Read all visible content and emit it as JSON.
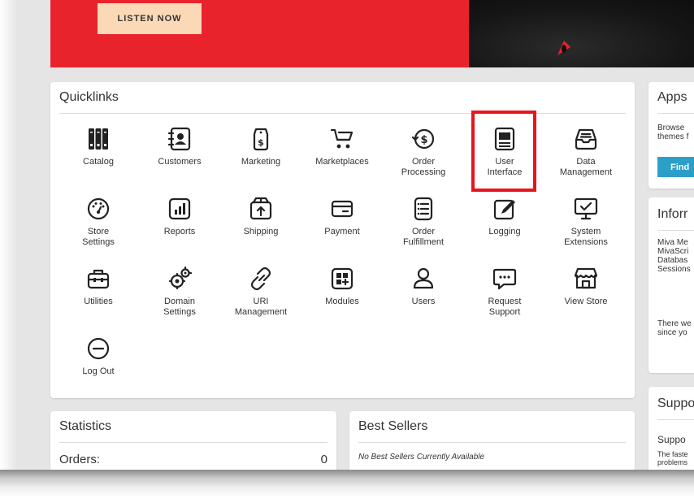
{
  "banner": {
    "listen_label": "LISTEN NOW"
  },
  "quicklinks": {
    "title": "Quicklinks",
    "items": [
      {
        "label": "Catalog"
      },
      {
        "label": "Customers"
      },
      {
        "label": "Marketing"
      },
      {
        "label": "Marketplaces"
      },
      {
        "label": "Order\nProcessing"
      },
      {
        "label": "User\nInterface"
      },
      {
        "label": "Data\nManagement"
      },
      {
        "label": "Store\nSettings"
      },
      {
        "label": "Reports"
      },
      {
        "label": "Shipping"
      },
      {
        "label": "Payment"
      },
      {
        "label": "Order\nFulfillment"
      },
      {
        "label": "Logging"
      },
      {
        "label": "System\nExtensions"
      },
      {
        "label": "Utilities"
      },
      {
        "label": "Domain\nSettings"
      },
      {
        "label": "URI\nManagement"
      },
      {
        "label": "Modules"
      },
      {
        "label": "Users"
      },
      {
        "label": "Request\nSupport"
      },
      {
        "label": "View Store"
      },
      {
        "label": "Log Out"
      }
    ]
  },
  "apps": {
    "title": "Apps",
    "line1": "Browse",
    "line2": "themes f",
    "find_label": "Find"
  },
  "information": {
    "title": "Inforr",
    "lines": [
      "Miva Me",
      "MivaScri",
      "Databas",
      "Sessions"
    ],
    "note1": "There we",
    "note2": "since yo"
  },
  "support": {
    "title": "Suppo",
    "subtitle": "Suppo",
    "line1": "The faste",
    "line2": "problems"
  },
  "statistics": {
    "title": "Statistics",
    "orders_label": "Orders:",
    "orders_value": "0"
  },
  "best_sellers": {
    "title": "Best Sellers",
    "empty_text": "No Best Sellers Currently Available"
  },
  "colors": {
    "banner_red": "#e8232b",
    "listen_button": "#fcd9b6",
    "highlight_red": "#e8141b",
    "find_button": "#2aa0c9"
  }
}
